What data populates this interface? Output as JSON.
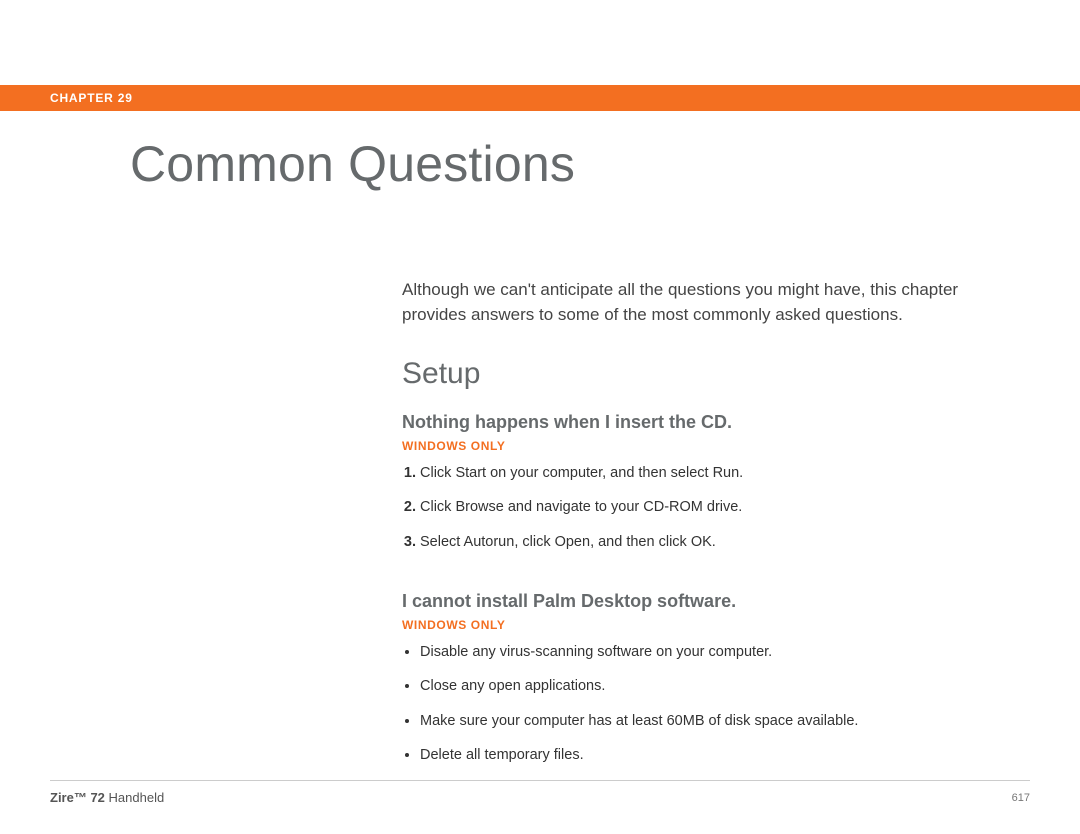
{
  "header": {
    "chapter_label": "CHAPTER 29"
  },
  "title": "Common Questions",
  "intro": "Although we can't anticipate all the questions you might have, this chapter provides answers to some of the most commonly asked questions.",
  "section": "Setup",
  "q1": {
    "question": "Nothing happens when I insert the CD.",
    "platform": "WINDOWS ONLY",
    "steps": [
      "Click Start on your computer, and then select Run.",
      "Click Browse and navigate to your CD-ROM drive.",
      "Select Autorun, click Open, and then click OK."
    ]
  },
  "q2": {
    "question": "I cannot install Palm Desktop software.",
    "platform": "WINDOWS ONLY",
    "bullets": [
      "Disable any virus-scanning software on your computer.",
      "Close any open applications.",
      "Make sure your computer has at least 60MB of disk space available.",
      "Delete all temporary files."
    ]
  },
  "footer": {
    "product_bold": "Zire™ 72",
    "product_rest": " Handheld",
    "page": "617"
  }
}
